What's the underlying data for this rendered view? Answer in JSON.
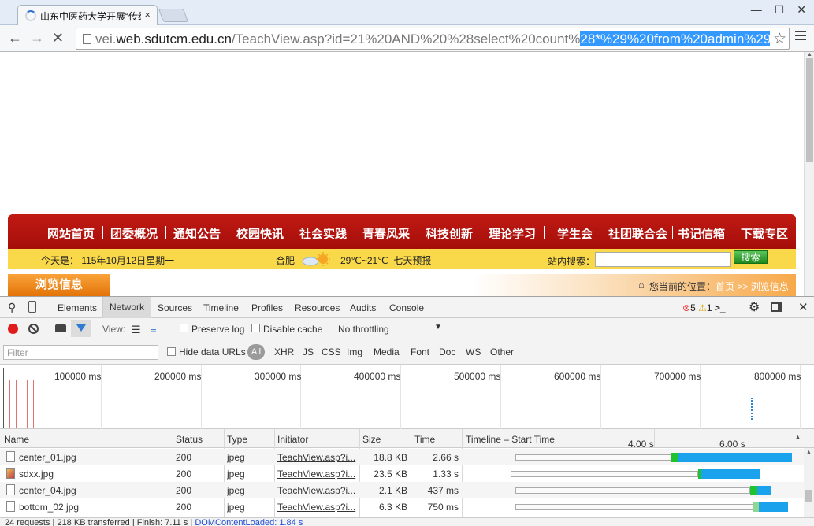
{
  "browser": {
    "tab_title": "山东中医药大学开展“传统",
    "tab_close": "×",
    "url_prefix": "vei.",
    "url_host": "web.sdutcm.edu.cn",
    "url_path": "/TeachView.asp?id=21%20AND%20%28select%20count%",
    "url_selected": "28*%29%20from%20admin%29",
    "window_controls": [
      "—",
      "☐",
      "✕"
    ]
  },
  "site": {
    "nav": [
      "网站首页",
      "团委概况",
      "通知公告",
      "校园快讯",
      "社会实践",
      "青春风采",
      "科技创新",
      "理论学习",
      "学生会",
      "社团联合会",
      "书记信箱",
      "下载专区"
    ],
    "date": "今天是： 115年10月12日星期一",
    "city": "合肥",
    "temperature": "29℃~21℃",
    "forecast": "七天预报",
    "search_label": "站内搜索：",
    "search_button": "搜索",
    "browse_tab": "浏览信息",
    "location_prefix": "您当前的位置：",
    "location_home": "首页",
    "location_sep": ">>",
    "location_page": "浏览信息"
  },
  "devtools": {
    "tabs": [
      "Elements",
      "Network",
      "Sources",
      "Timeline",
      "Profiles",
      "Resources",
      "Audits",
      "Console"
    ],
    "active_tab": "Network",
    "errors": "5",
    "warnings": "1",
    "view_label": "View:",
    "preserve_log": "Preserve log",
    "disable_cache": "Disable cache",
    "throttling": "No throttling",
    "filter_placeholder": "Filter",
    "hide_data_urls": "Hide data URLs",
    "filter_all": "All",
    "filter_types": [
      "XHR",
      "JS",
      "CSS",
      "Img",
      "Media",
      "Font",
      "Doc",
      "WS",
      "Other"
    ],
    "overview_ticks": [
      "100000 ms",
      "200000 ms",
      "300000 ms",
      "400000 ms",
      "500000 ms",
      "600000 ms",
      "700000 ms",
      "800000 ms"
    ],
    "columns": [
      "Name",
      "Status",
      "Type",
      "Initiator",
      "Size",
      "Time",
      "Timeline – Start Time"
    ],
    "timeline_ticks": [
      "4.00 s",
      "6.00 s"
    ],
    "rows": [
      {
        "name": "center_01.jpg",
        "status": "200",
        "type": "jpeg",
        "initiator": "TeachView.asp?i...",
        "size": "18.8 KB",
        "time": "2.66 s"
      },
      {
        "name": "sdxx.jpg",
        "status": "200",
        "type": "jpeg",
        "initiator": "TeachView.asp?i...",
        "size": "23.5 KB",
        "time": "1.33 s"
      },
      {
        "name": "center_04.jpg",
        "status": "200",
        "type": "jpeg",
        "initiator": "TeachView.asp?i...",
        "size": "2.1 KB",
        "time": "437 ms"
      },
      {
        "name": "bottom_02.jpg",
        "status": "200",
        "type": "jpeg",
        "initiator": "TeachView.asp?i...",
        "size": "6.3 KB",
        "time": "750 ms"
      }
    ],
    "status_summary": "24 requests | 218 KB transferred | Finish: 7.11 s |",
    "status_dcl": "DOMContentLoaded: 1.84 s"
  },
  "colors": {
    "nav_red": "#b3140f",
    "info_yellow": "#f9d84a",
    "browse_orange": "#ef8a1f",
    "url_selection": "#3399ff",
    "record_red": "#e01b1b",
    "timing_blue": "#1aa3ec",
    "timing_green": "#21c22f"
  }
}
